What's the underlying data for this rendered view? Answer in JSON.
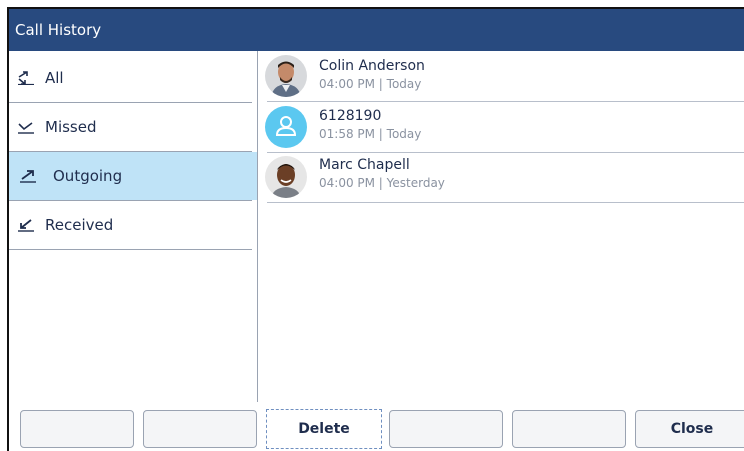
{
  "header": {
    "title": "Call History"
  },
  "sidebar": {
    "items": [
      {
        "label": "All",
        "icon": "all-calls-icon"
      },
      {
        "label": "Missed",
        "icon": "missed-call-icon"
      },
      {
        "label": "Outgoing",
        "icon": "outgoing-call-icon",
        "selected": true
      },
      {
        "label": "Received",
        "icon": "received-call-icon"
      }
    ]
  },
  "calls": [
    {
      "name": "Colin Anderson",
      "time": "04:00 PM | Today",
      "avatar": "contact-photo"
    },
    {
      "name": "6128190",
      "time": "01:58 PM | Today",
      "avatar": "default-contact-icon"
    },
    {
      "name": "Marc Chapell",
      "time": "04:00 PM | Yesterday",
      "avatar": "contact-photo"
    }
  ],
  "softkeys": {
    "k1": "",
    "k2": "",
    "delete": "Delete",
    "k4": "",
    "k5": "",
    "close": "Close"
  },
  "colors": {
    "title_bar": "#284a7f",
    "selected_item": "#bfe3f7",
    "default_avatar": "#5bc8f0"
  }
}
